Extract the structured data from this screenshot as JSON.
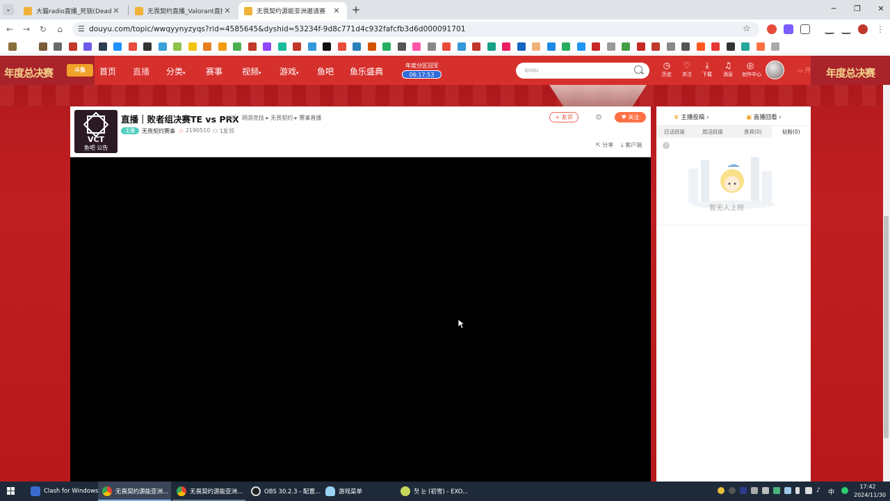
{
  "browser": {
    "tabs": [
      {
        "title": "大猫radio直播_死锁(DeadLock)",
        "active": false,
        "favicon_color": "#f1b23a"
      },
      {
        "title": "无畏契约直播_Valorant直播_无",
        "active": false,
        "favicon_color": "#f1b23a"
      },
      {
        "title": "无畏契约源能亚洲邀请赛",
        "active": true,
        "favicon_color": "#f1b23a"
      }
    ],
    "new_tab_icon": "plus-icon",
    "url": "douyu.com/topic/wwqyynyzyqs?rid=4585645&dyshid=53234f-9d8c771d4c932fafcfb3d6d000091701"
  },
  "site_header": {
    "brand_left": "年度总决赛",
    "brand_right": "年度总决赛",
    "logo_badge": "斗鱼",
    "nav": [
      {
        "label": "首页",
        "active": false
      },
      {
        "label": "直播",
        "active": true
      },
      {
        "label": "分类",
        "active": false,
        "caret": true
      },
      {
        "label": "赛事",
        "active": false
      },
      {
        "label": "视频",
        "active": false,
        "caret": true
      },
      {
        "label": "游戏",
        "active": false,
        "caret": true
      },
      {
        "label": "鱼吧",
        "active": false
      },
      {
        "label": "鱼乐盛典",
        "active": false
      }
    ],
    "annual_label": "年度分区冠军",
    "annual_timer": "06:17:53",
    "search_placeholder": "ququ",
    "icons": [
      {
        "name": "history",
        "label": "历史"
      },
      {
        "name": "follow",
        "label": "关注"
      },
      {
        "name": "download",
        "label": "下载"
      },
      {
        "name": "message",
        "label": "消息"
      },
      {
        "name": "creator",
        "label": "创作中心"
      }
    ],
    "kaibo": "开播"
  },
  "room": {
    "avatar_text": "VCT",
    "avatar_caption": "鱼吧   公告",
    "title": "直播｜败者组决赛TE vs PRX",
    "report": "举报",
    "breadcrumb": "网游竞技 ▸ 无畏契约 ▸ 赛事直播",
    "level": "主播",
    "anchor": "无畏契约赛事",
    "heat": "2190510",
    "fans": "1友邻",
    "friend_button": "+ 友邻",
    "follow_button": "♥ 关注",
    "share": "分享",
    "client": "客户端"
  },
  "side": {
    "link_left": "主播投稿 ›",
    "link_right": "直播回看 ›",
    "tabs": [
      "日活跃度",
      "周活跃度",
      "贵宾(0)",
      "钻粉(0)"
    ],
    "active_tab": 3,
    "empty_text": "暂无人上榜"
  },
  "taskbar": {
    "items": [
      {
        "label": "Clash for Windows",
        "active": false
      },
      {
        "label": "无畏契约源能亚洲...",
        "active": true
      },
      {
        "label": "无畏契约源能亚洲...",
        "active": false
      },
      {
        "label": "OBS 30.2.3 - 配置...",
        "active": false
      },
      {
        "label": "游戏菜单",
        "active": false
      },
      {
        "label": "첫 눈 (初雪) - EXO...",
        "active": false
      }
    ],
    "ime": "中",
    "time": "17:42",
    "date": "2024/11/30"
  },
  "colors": {
    "header_red": "#d6302d",
    "follow_orange": "#ff7043",
    "taskbar": "#1e2a3a"
  }
}
